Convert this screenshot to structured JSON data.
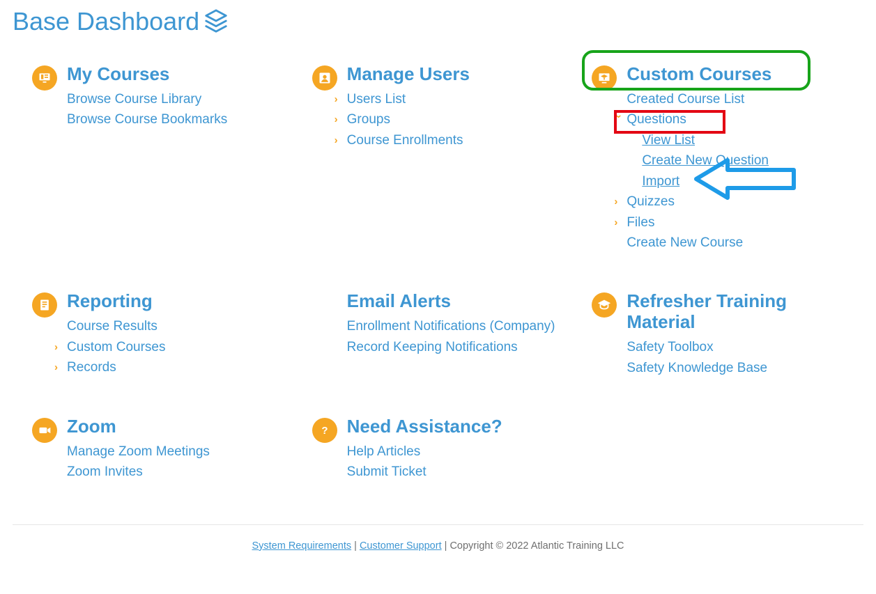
{
  "page_title": "Base Dashboard",
  "cards": {
    "my_courses": {
      "title": "My Courses",
      "links": [
        "Browse Course Library",
        "Browse Course Bookmarks"
      ]
    },
    "manage_users": {
      "title": "Manage Users",
      "links": [
        "Users List",
        "Groups",
        "Course Enrollments"
      ]
    },
    "custom_courses": {
      "title": "Custom Courses",
      "created_list": "Created Course List",
      "questions_label": "Questions",
      "questions_sub": [
        "View List",
        "Create New Question",
        "Import"
      ],
      "quizzes": "Quizzes",
      "files": "Files",
      "create_new": "Create New Course"
    },
    "reporting": {
      "title": "Reporting",
      "links": [
        "Course Results",
        "Custom Courses",
        "Records"
      ]
    },
    "email_alerts": {
      "title": "Email Alerts",
      "links": [
        "Enrollment Notifications (Company)",
        "Record Keeping Notifications"
      ]
    },
    "refresher": {
      "title": "Refresher Training Material",
      "links": [
        "Safety Toolbox",
        "Safety Knowledge Base"
      ]
    },
    "zoom": {
      "title": "Zoom",
      "links": [
        "Manage Zoom Meetings",
        "Zoom Invites"
      ]
    },
    "need_assistance": {
      "title": "Need Assistance?",
      "links": [
        "Help Articles",
        "Submit Ticket"
      ]
    }
  },
  "footer": {
    "sys_req": "System Requirements",
    "support": "Customer Support",
    "copyright": "Copyright © 2022 Atlantic Training LLC"
  }
}
